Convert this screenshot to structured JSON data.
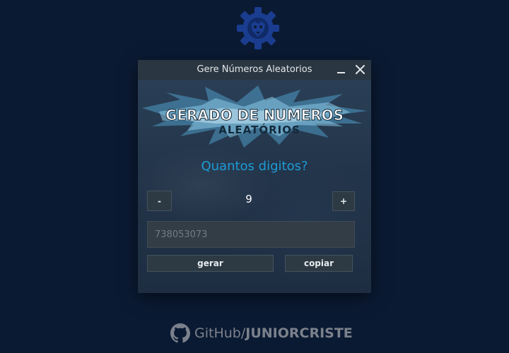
{
  "colors": {
    "background": "#0b1a33",
    "accent": "#1e9ad6",
    "titlebar": "#2a3641"
  },
  "desktop": {
    "logo_icon": "gear-lion-logo-icon"
  },
  "window": {
    "title": "Gere Números Aleatorios",
    "minimize_icon": "minimize-icon",
    "close_icon": "close-icon"
  },
  "banner": {
    "line1": "GERADO DE NUMEROS",
    "line2": "ALEATÓRIOS"
  },
  "main": {
    "question": "Quantos digitos?",
    "minus_label": "-",
    "plus_label": "+",
    "digit_count": "9",
    "result_value": "738053073",
    "generate_label": "gerar",
    "copy_label": "copiar"
  },
  "footer": {
    "github_icon": "github-icon",
    "github_text": "GitHub/",
    "github_user": "JUNIORCRISTE"
  }
}
